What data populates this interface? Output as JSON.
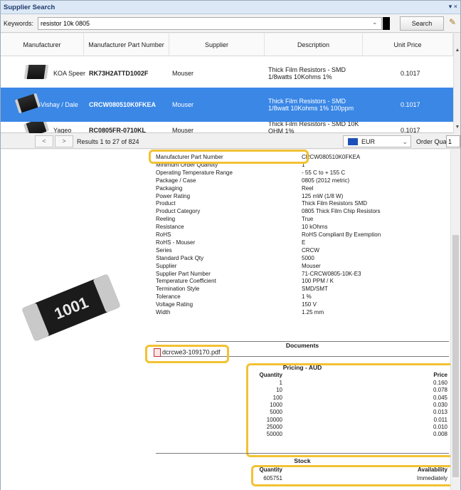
{
  "window": {
    "title": "Supplier Search",
    "title_icons": "▾ ×"
  },
  "keywords": {
    "label": "Keywords:",
    "value": "resistor 10k 0805",
    "dropdown": "⌄",
    "search_label": "Search",
    "edit_glyph": "✎"
  },
  "grid": {
    "columns": [
      "Manufacturer",
      "Manufacturer Part Number",
      "Supplier",
      "Description",
      "Unit Price"
    ],
    "rows": [
      {
        "manufacturer": "KOA Speer",
        "mpn": "RK73H2ATTD1002F",
        "supplier": "Mouser",
        "description": "Thick Film Resistors - SMD 1/8watts 10Kohms 1%",
        "price": "0.1017"
      },
      {
        "manufacturer": "Vishay / Dale",
        "mpn": "CRCW080510K0FKEA",
        "supplier": "Mouser",
        "description": "Thick Film Resistors - SMD 1/8watt 10Kohms 1% 100ppm",
        "price": "0.1017"
      },
      {
        "manufacturer": "Yageo",
        "mpn": "RC0805FR-0710KL",
        "supplier": "Mouser",
        "description": "Thick Film Resistors - SMD 10K OHM 1%",
        "price": "0.1017"
      }
    ],
    "scroll_up": "▲",
    "scroll_down": "▼"
  },
  "nav": {
    "prev": "<",
    "next": ">",
    "results": "Results 1 to 27 of 824",
    "currency": "EUR",
    "currency_dd": "⌄",
    "order_qty_label": "Order Quantity:",
    "order_qty": "1"
  },
  "detail": {
    "chip_marking": "1001",
    "params": [
      {
        "k": "Manufacturer Part Number",
        "v": "CRCW080510K0FKEA"
      },
      {
        "k": "Minimum Order Quantity",
        "v": "1"
      },
      {
        "k": "Operating Temperature Range",
        "v": "- 55 C to + 155 C"
      },
      {
        "k": "Package / Case",
        "v": "0805 (2012 metric)"
      },
      {
        "k": "Packaging",
        "v": "Reel"
      },
      {
        "k": "Power Rating",
        "v": "125 mW (1/8 W)"
      },
      {
        "k": "Product",
        "v": "Thick Film Resistors SMD"
      },
      {
        "k": "Product Category",
        "v": "0805 Thick Film Chip Resistors"
      },
      {
        "k": "Reeling",
        "v": "True"
      },
      {
        "k": "Resistance",
        "v": "10 kOhms"
      },
      {
        "k": "RoHS",
        "v": "RoHS Compliant By Exemption"
      },
      {
        "k": "RoHS - Mouser",
        "v": "E"
      },
      {
        "k": "Series",
        "v": "CRCW"
      },
      {
        "k": "Standard Pack Qty",
        "v": "5000"
      },
      {
        "k": "Supplier",
        "v": "Mouser"
      },
      {
        "k": "Supplier Part Number",
        "v": "71-CRCW0805-10K-E3"
      },
      {
        "k": "Temperature Coefficient",
        "v": "100 PPM / K"
      },
      {
        "k": "Termination Style",
        "v": "SMD/SMT"
      },
      {
        "k": "Tolerance",
        "v": "1 %"
      },
      {
        "k": "Voltage Rating",
        "v": "150 V"
      },
      {
        "k": "Width",
        "v": "1.25 mm"
      }
    ],
    "documents_header": "Documents",
    "document": "dcrcwe3-109170.pdf",
    "pricing_header": "Pricing - AUD",
    "pricing_cols": {
      "q": "Quantity",
      "p": "Price"
    },
    "pricing": [
      {
        "q": "1",
        "p": "0.160"
      },
      {
        "q": "10",
        "p": "0.078"
      },
      {
        "q": "100",
        "p": "0.045"
      },
      {
        "q": "1000",
        "p": "0.030"
      },
      {
        "q": "5000",
        "p": "0.013"
      },
      {
        "q": "10000",
        "p": "0.011"
      },
      {
        "q": "25000",
        "p": "0.010"
      },
      {
        "q": "50000",
        "p": "0.008"
      }
    ],
    "stock_header": "Stock",
    "stock_cols": {
      "q": "Quantity",
      "a": "Availability"
    },
    "stock": {
      "q": "605751",
      "a": "Immediately"
    }
  },
  "colors": {
    "selection": "#3a87e6",
    "highlight": "#f2c233"
  }
}
